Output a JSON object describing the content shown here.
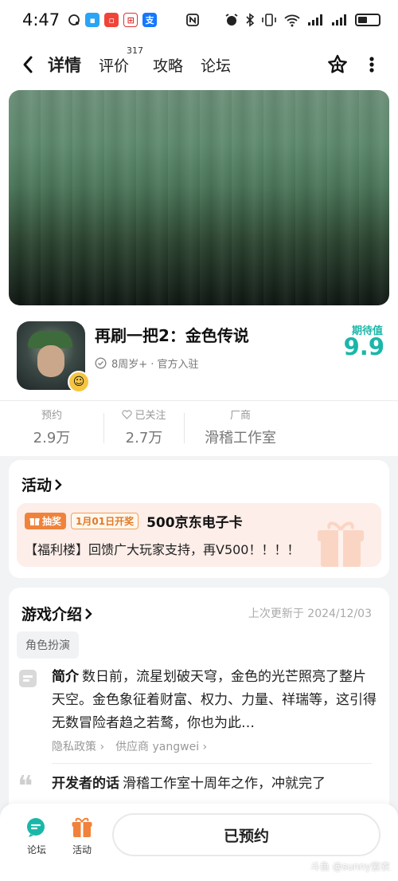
{
  "status_bar": {
    "time": "4:47",
    "left_icons": [
      "chat-bubble-icon",
      "app-blue-icon",
      "app-red-icon",
      "app-train-icon",
      "alipay-icon",
      "nfc-icon"
    ],
    "right_icons": [
      "alarm-icon",
      "bluetooth-icon",
      "vibrate-icon",
      "wifi-icon",
      "signal-icon",
      "signal-icon",
      "battery-icon"
    ],
    "battery_level": 0.45
  },
  "nav": {
    "tabs": [
      {
        "label": "详情",
        "active": true
      },
      {
        "label": "评价",
        "count": "317"
      },
      {
        "label": "攻略"
      },
      {
        "label": "论坛"
      }
    ]
  },
  "game": {
    "title": "再刷一把2：金色传说",
    "tags": "8周岁+ · 官方入驻",
    "expect_label": "期待值",
    "expect_value": "9.9"
  },
  "stats": [
    {
      "label": "预约",
      "value": "2.9万"
    },
    {
      "label": "已关注",
      "value": "2.7万"
    },
    {
      "label": "厂商",
      "value": "滑稽工作室"
    }
  ],
  "activity": {
    "title": "活动",
    "badge": "抽奖",
    "date": "1月01日开奖",
    "prize": "500京东电子卡",
    "desc": "【福利楼】回馈广大玩家支持，再V500！！！！"
  },
  "intro": {
    "title": "游戏介绍",
    "updated": "上次更新于 2024/12/03",
    "genre": "角色扮演",
    "summary_label": "简介",
    "summary": "数日前，流星划破天穹，金色的光芒照亮了整片天空。金色象征着财富、权力、力量、祥瑞等，这引得无数冒险者趋之若鹜，你也为此…",
    "privacy": "隐私政策",
    "supplier": "供应商 yangwei",
    "dev_label": "开发者的话",
    "dev_text": "滑稽工作室十周年之作，冲就完了"
  },
  "bottom": {
    "forum": "论坛",
    "activity": "活动",
    "reserve": "已预约"
  },
  "watermark": "斗鱼 @sunny紫衣",
  "colors": {
    "accent": "#1ab7a8",
    "tab_highlight": "#22c7b8",
    "orange": "#f0823a"
  }
}
